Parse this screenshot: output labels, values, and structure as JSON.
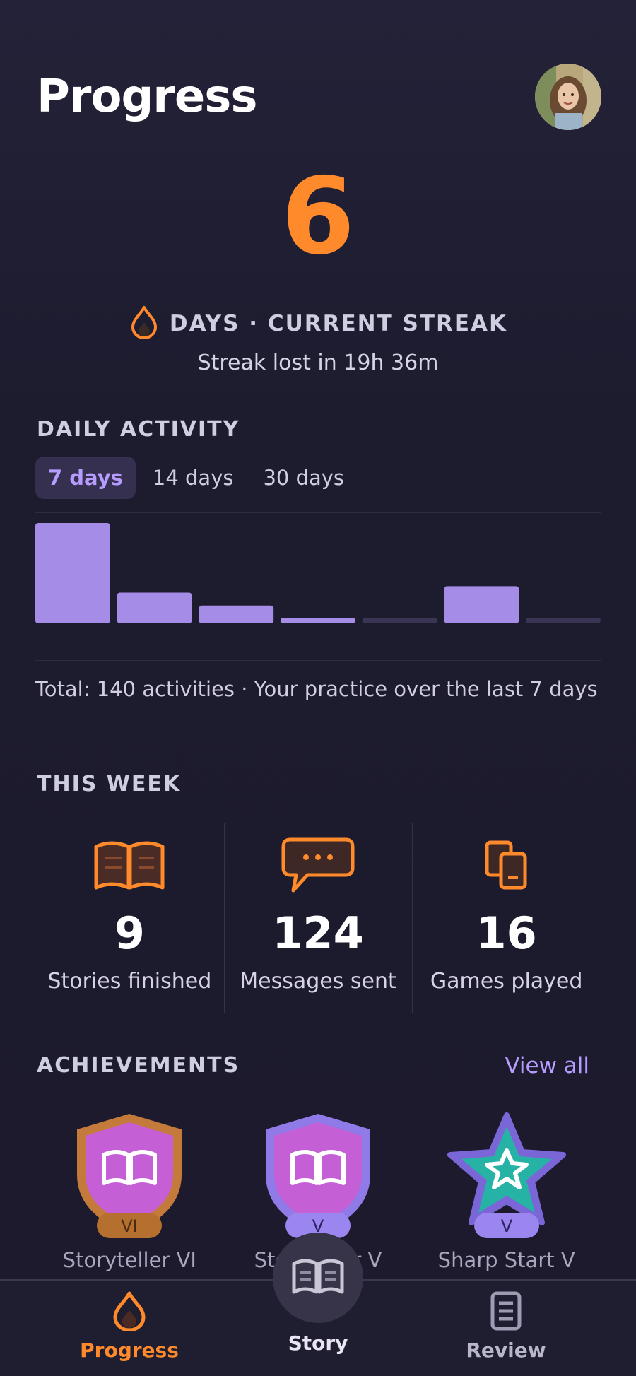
{
  "header": {
    "title": "Progress",
    "avatar_icon": "user-avatar"
  },
  "streak": {
    "count": "6",
    "label": "DAYS · CURRENT STREAK",
    "sub": "Streak lost in 19h 36m",
    "icon": "flame-icon",
    "color": "#ff8a2b"
  },
  "daily_activity": {
    "title": "DAILY ACTIVITY",
    "tabs": [
      {
        "label": "7 days",
        "active": true
      },
      {
        "label": "14 days",
        "active": false
      },
      {
        "label": "30 days",
        "active": false
      }
    ],
    "total_text": "Total:  140 activities · Your practice over the last 7 days"
  },
  "chart_data": {
    "type": "bar",
    "categories": [
      "",
      "",
      "",
      "",
      "",
      "",
      ""
    ],
    "values": [
      62,
      19,
      11,
      3,
      0,
      23,
      0
    ],
    "xlabel": "",
    "ylabel": "",
    "ylim": [
      0,
      62
    ],
    "grid": false,
    "bar_color": "#a58ce6",
    "empty_color": "#3b3555"
  },
  "this_week": {
    "title": "THIS WEEK",
    "stats": [
      {
        "icon": "book-icon",
        "value": "9",
        "label": "Stories finished"
      },
      {
        "icon": "chat-bubble-icon",
        "value": "124",
        "label": "Messages sent"
      },
      {
        "icon": "cards-icon",
        "value": "16",
        "label": "Games played"
      }
    ]
  },
  "achievements": {
    "title": "ACHIEVEMENTS",
    "view_all": "View all",
    "badges": [
      {
        "icon": "bronze-shield-book-badge",
        "tier": "VI",
        "label": "Storyteller VI"
      },
      {
        "icon": "purple-shield-book-badge",
        "tier": "V",
        "label": "Storyteller V"
      },
      {
        "icon": "teal-star-badge",
        "tier": "V",
        "label": "Sharp Start V"
      }
    ]
  },
  "nav": {
    "items": [
      {
        "label": "Progress",
        "icon": "flame-icon",
        "active": true
      },
      {
        "label": "Story",
        "icon": "book-icon",
        "active": false
      },
      {
        "label": "Review",
        "icon": "list-icon",
        "active": false
      }
    ],
    "active_color": "#ff8a2b"
  }
}
